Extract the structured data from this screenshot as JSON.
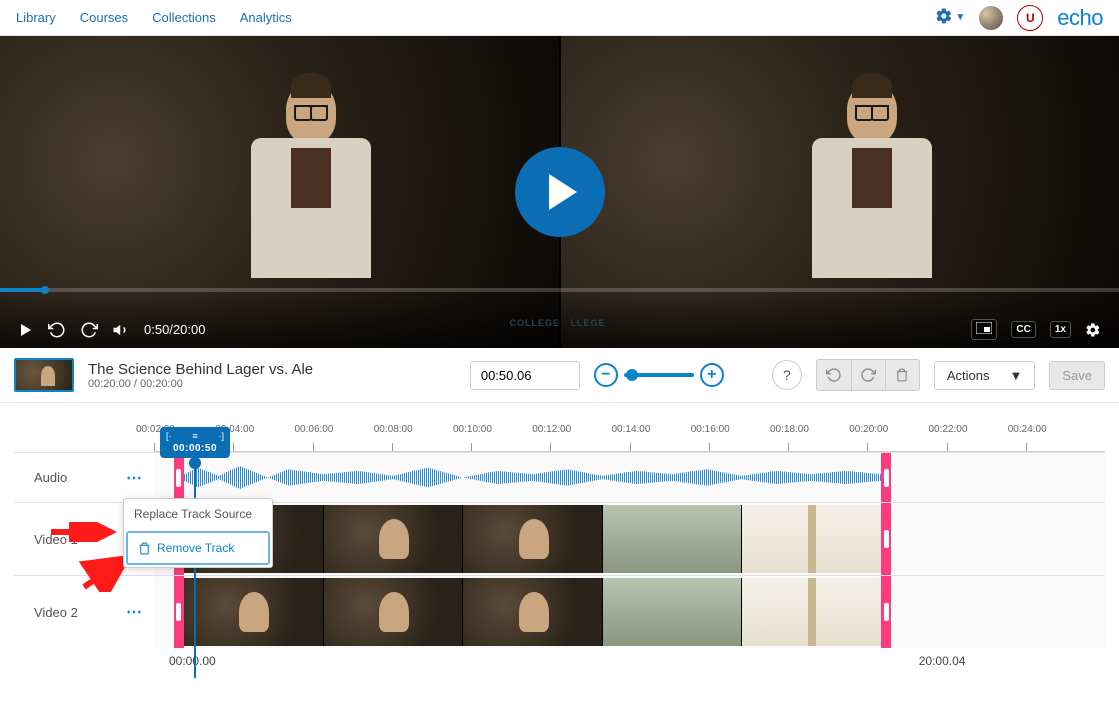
{
  "nav": {
    "items": [
      "Library",
      "Courses",
      "Collections",
      "Analytics"
    ],
    "brand": "echo"
  },
  "player": {
    "time_display": "0:50/20:00",
    "cc_label": "CC",
    "speed_label": "1x",
    "college_label": "COLLEGE"
  },
  "editor": {
    "title": "The Science Behind Lager vs. Ale",
    "duration_display": "00:20:00 / 00:20:00",
    "time_input_value": "00:50.06",
    "actions_label": "Actions",
    "save_label": "Save"
  },
  "playhead": {
    "time": "00:00:50"
  },
  "ruler": [
    "00:02:00",
    "00:04:00",
    "00:06:00",
    "00:08:00",
    "00:10:00",
    "00:12:00",
    "00:14:00",
    "00:16:00",
    "00:18:00",
    "00:20:00",
    "00:22:00",
    "00:24:00"
  ],
  "tracks": {
    "audio_label": "Audio",
    "video1_label": "Video 1",
    "video2_label": "Video 2",
    "menu_glyph": "⋯"
  },
  "context_menu": {
    "replace_label": "Replace Track Source",
    "remove_label": "Remove Track"
  },
  "footer": {
    "start": "00:00.00",
    "end": "20:00.04"
  }
}
